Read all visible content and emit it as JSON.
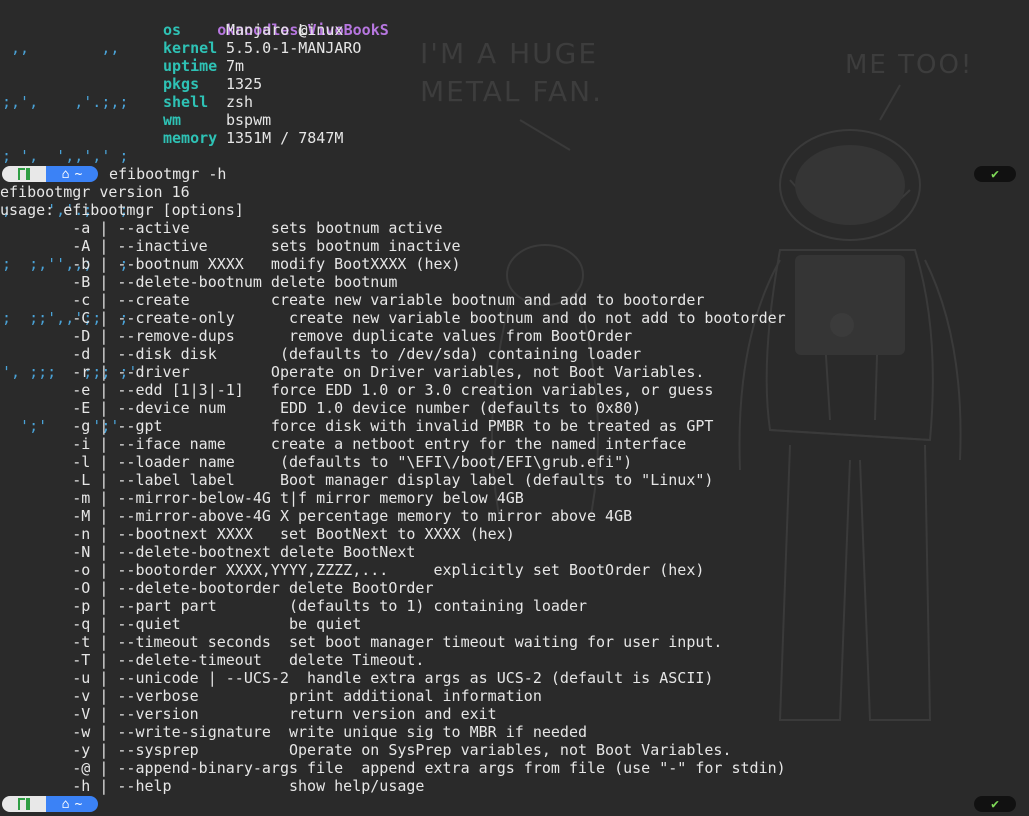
{
  "neofetch": {
    "logo_lines": [
      " ,,        ,,  ",
      ";,',    ,'.;,;",
      "; ',  ',,',' ;",
      ";    ','.;   ;",
      ";  ;,'',,;   ;",
      ";  ;;',,';;  ;",
      "', ;;;   ;;; ;'",
      "  ';'     ';'  "
    ],
    "user": "oknoodles",
    "at": "@",
    "host": "VivoBookS",
    "rows": [
      {
        "key": "os",
        "value": "Manjaro Linux"
      },
      {
        "key": "kernel",
        "value": "5.5.0-1-MANJARO"
      },
      {
        "key": "uptime",
        "value": "7m"
      },
      {
        "key": "pkgs",
        "value": "1325"
      },
      {
        "key": "shell",
        "value": "zsh"
      },
      {
        "key": "wm",
        "value": "bspwm"
      },
      {
        "key": "memory",
        "value": "1351M / 7847M"
      }
    ]
  },
  "wallpaper": {
    "speech1": "I'M A HUGE\nMETAL FAN.",
    "speech2": "ME TOO!"
  },
  "prompt": {
    "os_icon": "manjaro-icon",
    "dir_icon": "home-icon",
    "dir": "~",
    "command": "efibootmgr -h",
    "status": "✔",
    "colors": {
      "os_bg": "#e8e8e8",
      "dir_bg": "#3b82f6",
      "status_fg": "#7ed957"
    }
  },
  "output": {
    "version": "efibootmgr version 16",
    "usage": "usage: efibootmgr [options]",
    "options": [
      "        -a | --active         sets bootnum active",
      "        -A | --inactive       sets bootnum inactive",
      "        -b | --bootnum XXXX   modify BootXXXX (hex)",
      "        -B | --delete-bootnum delete bootnum",
      "        -c | --create         create new variable bootnum and add to bootorder",
      "        -C | --create-only      create new variable bootnum and do not add to bootorder",
      "        -D | --remove-dups      remove duplicate values from BootOrder",
      "        -d | --disk disk       (defaults to /dev/sda) containing loader",
      "        -r | --driver         Operate on Driver variables, not Boot Variables.",
      "        -e | --edd [1|3|-1]   force EDD 1.0 or 3.0 creation variables, or guess",
      "        -E | --device num      EDD 1.0 device number (defaults to 0x80)",
      "        -g | --gpt            force disk with invalid PMBR to be treated as GPT",
      "        -i | --iface name     create a netboot entry for the named interface",
      "        -l | --loader name     (defaults to \"\\EFI\\/boot/EFI\\grub.efi\")",
      "        -L | --label label     Boot manager display label (defaults to \"Linux\")",
      "        -m | --mirror-below-4G t|f mirror memory below 4GB",
      "        -M | --mirror-above-4G X percentage memory to mirror above 4GB",
      "        -n | --bootnext XXXX   set BootNext to XXXX (hex)",
      "        -N | --delete-bootnext delete BootNext",
      "        -o | --bootorder XXXX,YYYY,ZZZZ,...     explicitly set BootOrder (hex)",
      "        -O | --delete-bootorder delete BootOrder",
      "        -p | --part part        (defaults to 1) containing loader",
      "        -q | --quiet            be quiet",
      "        -t | --timeout seconds  set boot manager timeout waiting for user input.",
      "        -T | --delete-timeout   delete Timeout.",
      "        -u | --unicode | --UCS-2  handle extra args as UCS-2 (default is ASCII)",
      "        -v | --verbose          print additional information",
      "        -V | --version          return version and exit",
      "        -w | --write-signature  write unique sig to MBR if needed",
      "        -y | --sysprep          Operate on SysPrep variables, not Boot Variables.",
      "        -@ | --append-binary-args file  append extra args from file (use \"-\" for stdin)",
      "        -h | --help             show help/usage"
    ]
  }
}
